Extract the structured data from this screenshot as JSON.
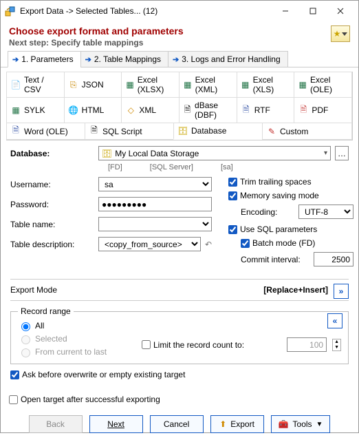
{
  "window": {
    "title": "Export Data -> Selected Tables... (12)"
  },
  "header": {
    "title": "Choose export format and parameters",
    "subtitle": "Next step: Specify table mappings"
  },
  "wizard": {
    "tabs": [
      {
        "label": "1. Parameters"
      },
      {
        "label": "2. Table Mappings"
      },
      {
        "label": "3. Logs and Error Handling"
      }
    ]
  },
  "formats": {
    "row1": [
      "Text / CSV",
      "JSON",
      "Excel (XLSX)",
      "Excel (XML)",
      "Excel (XLS)",
      "Excel (OLE)"
    ],
    "row2": [
      "SYLK",
      "HTML",
      "XML",
      "dBase (DBF)",
      "RTF",
      "PDF"
    ],
    "row3": [
      "Word (OLE)",
      "SQL Script",
      "Database",
      "Custom"
    ]
  },
  "db": {
    "label": "Database:",
    "value": "My Local Data Storage",
    "hints": [
      "[FD]",
      "[SQL Server]",
      "[sa]"
    ],
    "usernameLabel": "Username:",
    "username": "sa",
    "passwordLabel": "Password:",
    "password": "●●●●●●●●●",
    "tableNameLabel": "Table name:",
    "tableName": "",
    "tableDescLabel": "Table description:",
    "tableDescOption": "<copy_from_source>"
  },
  "opts": {
    "trim": "Trim trailing spaces",
    "memory": "Memory saving mode",
    "encodingLabel": "Encoding:",
    "encoding": "UTF-8",
    "sqlParams": "Use SQL parameters",
    "batch": "Batch mode (FD)",
    "commitLabel": "Commit interval:",
    "commit": "2500"
  },
  "exportMode": {
    "label": "Export Mode",
    "value": "[Replace+Insert]"
  },
  "recordRange": {
    "legend": "Record range",
    "all": "All",
    "selected": "Selected",
    "current": "From current to last",
    "limitLabel": "Limit the record count to:",
    "limit": "100"
  },
  "askOverwrite": "Ask before overwrite or empty existing target",
  "openAfter": "Open target after successful exporting",
  "buttons": {
    "back": "Back",
    "next": "Next",
    "cancel": "Cancel",
    "export": "Export",
    "tools": "Tools"
  }
}
